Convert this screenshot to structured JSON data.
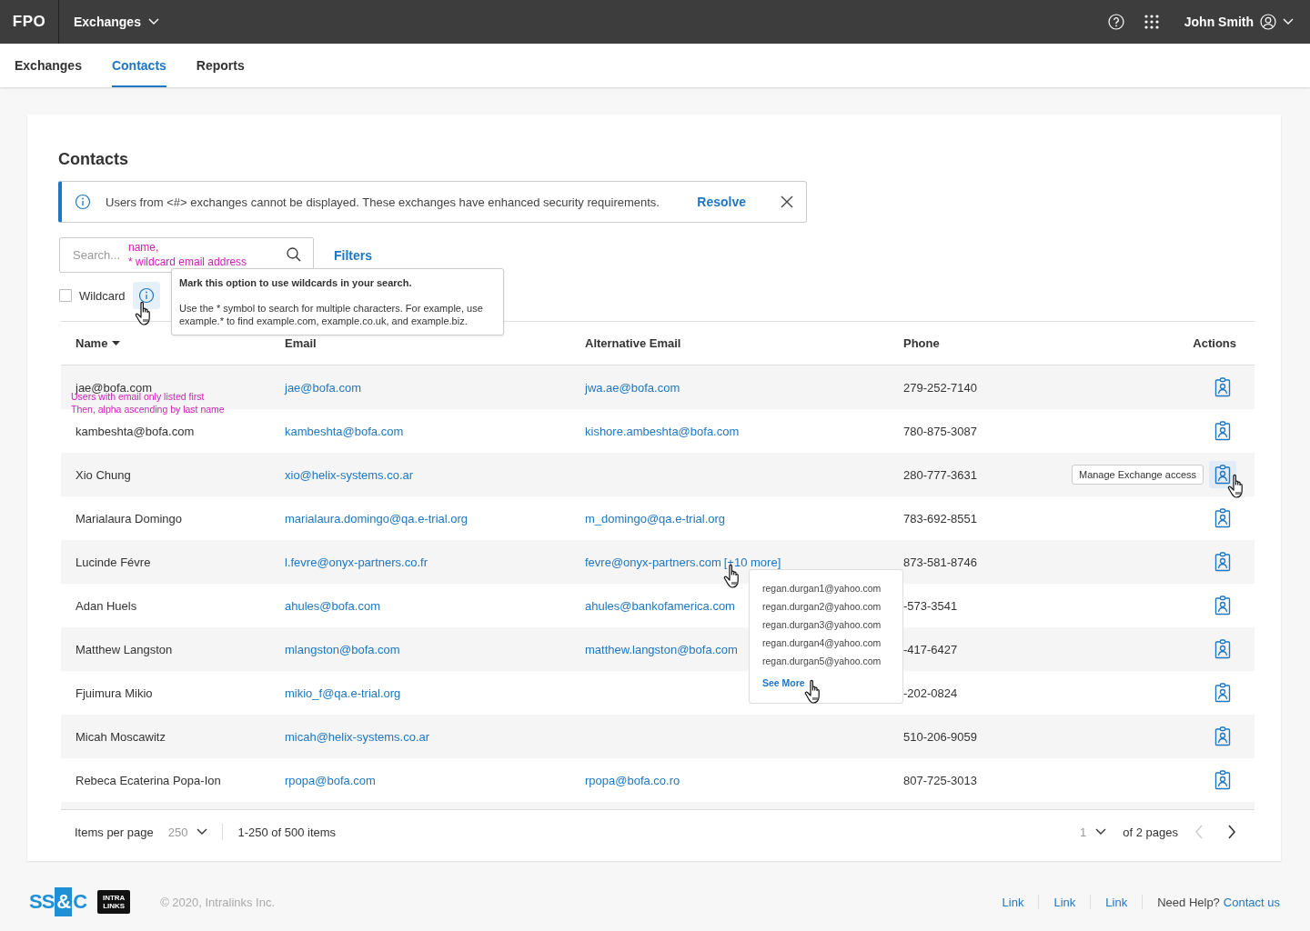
{
  "topbar": {
    "logo": "FPO",
    "app_menu": "Exchanges",
    "user": "John Smith"
  },
  "tabs": [
    {
      "label": "Exchanges",
      "selected": false
    },
    {
      "label": "Contacts",
      "selected": true
    },
    {
      "label": "Reports",
      "selected": false
    }
  ],
  "card": {
    "title": "Contacts",
    "banner": {
      "message": "Users from <#> exchanges cannot be displayed. These exchanges have enhanced security requirements.",
      "action": "Resolve"
    },
    "search": {
      "placeholder": "Search...",
      "annotation": [
        "name,",
        "* wildcard email address"
      ]
    },
    "filters": "Filters",
    "wildcard": {
      "label": "Wildcard",
      "checked": false,
      "tooltip": {
        "title": "Mark this option to use wildcards in your search.",
        "body": "Use the * symbol to search for multiple characters. For example, use example.* to find example.com, example.co.uk, and example.biz."
      }
    },
    "table": {
      "columns": [
        "Name",
        "Email",
        "Alternative Email",
        "Phone",
        "Actions"
      ],
      "action_tooltip": "Manage Exchange access",
      "rows": [
        {
          "name": "jae@bofa.com",
          "email": "jae@bofa.com",
          "alt_email": "jwa.ae@bofa.com",
          "phone": "279-252-7140",
          "hovered": false,
          "note": [
            "Users with email only listed first",
            "Then, alpha ascending by last name"
          ]
        },
        {
          "name": "kambeshta@bofa.com",
          "email": "kambeshta@bofa.com",
          "alt_email": "kishore.ambeshta@bofa.com",
          "phone": "780-875-3087",
          "hovered": false
        },
        {
          "name": "Xio Chung",
          "email": "xio@helix-systems.co.ar",
          "phone": "280-777-3631",
          "hovered": true
        },
        {
          "name": "Marialaura Domingo",
          "email": "marialaura.domingo@qa.e-trial.org",
          "alt_email": "m_domingo@qa.e-trial.org",
          "phone": "783-692-8551",
          "hovered": false
        },
        {
          "name": "Lucinde Févre",
          "email": "l.fevre@onyx-partners.co.fr",
          "alt_email": "fevre@onyx-partners.com",
          "more": "[+10 more]",
          "more_popover": {
            "emails": [
              "regan.durgan1@yahoo.com",
              "regan.durgan2@yahoo.com",
              "regan.durgan3@yahoo.com",
              "regan.durgan4@yahoo.com",
              "regan.durgan5@yahoo.com"
            ],
            "see_more": "See More"
          },
          "phone": "873-581-8746",
          "hovered": false
        },
        {
          "name": "Adan Huels",
          "email": "ahules@bofa.com",
          "alt_email": "ahules@bankofamerica.com",
          "phone": "-573-3541",
          "hovered": false
        },
        {
          "name": "Matthew Langston",
          "email": "mlangston@bofa.com",
          "alt_email": "matthew.langston@bofa.com",
          "phone": "-417-6427",
          "hovered": false
        },
        {
          "name": "Fjuimura Mikio",
          "email": "mikio_f@qa.e-trial.org",
          "phone": "-202-0824",
          "hovered": false
        },
        {
          "name": "Micah Moscawitz",
          "email": "micah@helix-systems.co.ar",
          "phone": "510-206-9059",
          "hovered": false
        },
        {
          "name": "Rebeca Ecaterina Popa-Ion",
          "email": "rpopa@bofa.com",
          "alt_email": "rpopa@bofa.co.ro",
          "phone": "807-725-3013",
          "hovered": false
        }
      ]
    },
    "pagination": {
      "items_label": "Items per page",
      "per_page": "250",
      "range": "1-250 of 500 items",
      "page": "1",
      "pages": "of 2 pages",
      "prev_disabled": true
    }
  },
  "footer": {
    "logo_parts": [
      "SS",
      "&",
      "C"
    ],
    "intralinks_logo": [
      "INTRA",
      "LINKS"
    ],
    "copyright": "© 2020, Intralinks Inc.",
    "links": [
      "Link",
      "Link",
      "Link"
    ],
    "help": "Need Help?",
    "contact": "Contact us"
  }
}
